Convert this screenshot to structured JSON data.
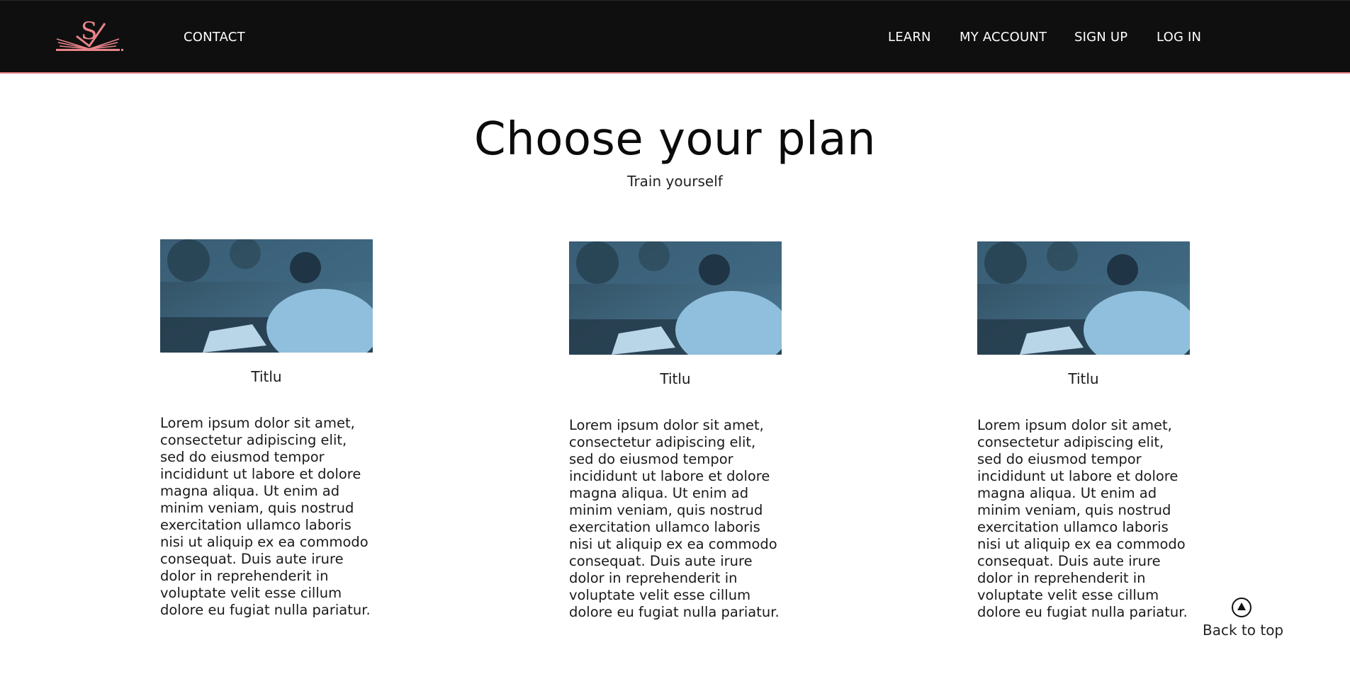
{
  "header": {
    "logo_letter": "S",
    "nav_left": [
      {
        "label": "CONTACT"
      }
    ],
    "nav_right": [
      {
        "label": "LEARN"
      },
      {
        "label": "MY ACCOUNT"
      },
      {
        "label": "SIGN UP"
      },
      {
        "label": "LOG IN"
      }
    ],
    "accent_color": "#e8848a"
  },
  "hero": {
    "title": "Choose your plan",
    "subtitle": "Train yourself"
  },
  "cards": [
    {
      "title": "Titlu",
      "body": "Lorem ipsum dolor sit amet, consectetur adipiscing elit, sed do eiusmod tempor incididunt ut labore et dolore magna aliqua. Ut enim ad minim veniam, quis nostrud exercitation ullamco laboris nisi ut aliquip ex ea commodo consequat. Duis aute irure dolor in reprehenderit in voluptate velit esse cillum dolore eu fugiat nulla pariatur."
    },
    {
      "title": "Titlu",
      "body": "Lorem ipsum dolor sit amet, consectetur adipiscing elit, sed do eiusmod tempor incididunt ut labore et dolore magna aliqua. Ut enim ad minim veniam, quis nostrud exercitation ullamco laboris nisi ut aliquip ex ea commodo consequat. Duis aute irure dolor in reprehenderit in voluptate velit esse cillum dolore eu fugiat nulla pariatur."
    },
    {
      "title": "Titlu",
      "body": "Lorem ipsum dolor sit amet, consectetur adipiscing elit, sed do eiusmod tempor incididunt ut labore et dolore magna aliqua. Ut enim ad minim veniam, quis nostrud exercitation ullamco laboris nisi ut aliquip ex ea commodo consequat. Duis aute irure dolor in reprehenderit in voluptate velit esse cillum dolore eu fugiat nulla pariatur."
    }
  ],
  "back_to_top": {
    "label": "Back to top",
    "icon": "arrow-up-circle-icon"
  }
}
